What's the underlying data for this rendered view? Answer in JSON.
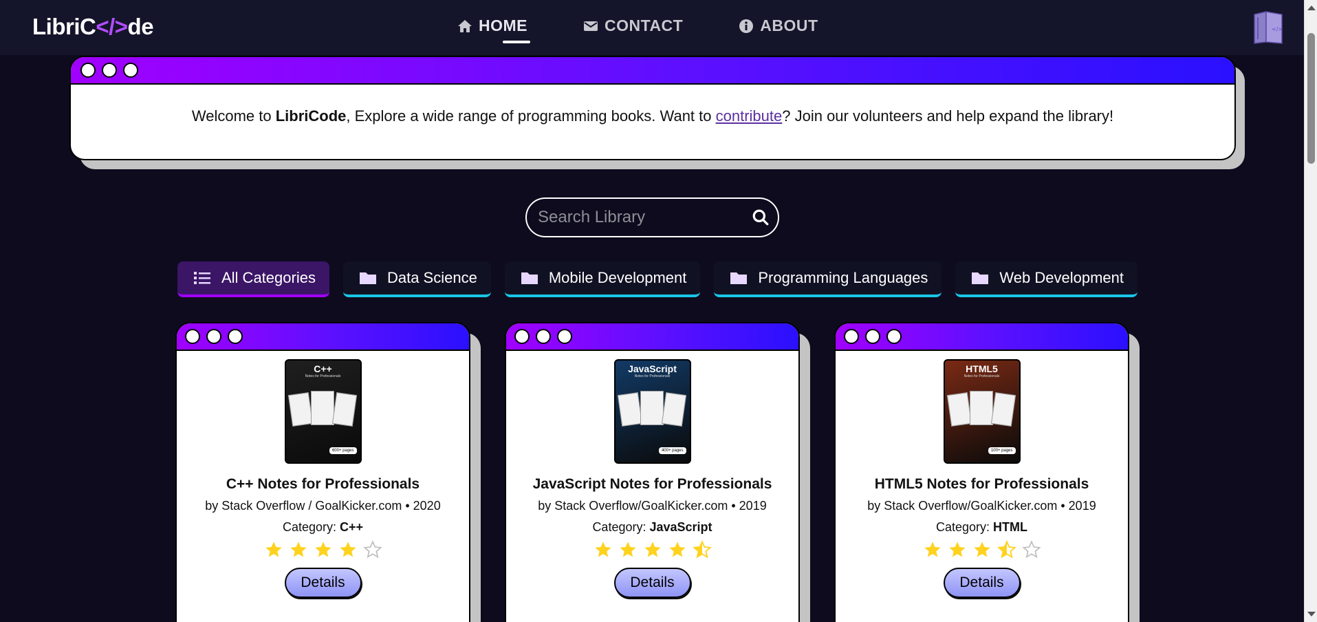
{
  "nav": {
    "logo_prefix": "LibriC",
    "logo_code": "</>",
    "logo_suffix": "de",
    "links": [
      {
        "label": "HOME",
        "icon": "home-icon"
      },
      {
        "label": "CONTACT",
        "icon": "envelope-icon"
      },
      {
        "label": "ABOUT",
        "icon": "info-icon"
      }
    ]
  },
  "welcome": {
    "pre": "Welcome to ",
    "brand": "LibriCode",
    "mid": ", Explore a wide range of programming books. Want to ",
    "link": "contribute",
    "post": "? Join our volunteers and help expand the library!"
  },
  "search": {
    "placeholder": "Search Library"
  },
  "categories": [
    {
      "label": "All Categories",
      "icon": "list-icon"
    },
    {
      "label": "Data Science",
      "icon": "folder-icon"
    },
    {
      "label": "Mobile Development",
      "icon": "folder-icon"
    },
    {
      "label": "Programming Languages",
      "icon": "folder-icon"
    },
    {
      "label": "Web Development",
      "icon": "folder-icon"
    }
  ],
  "books": [
    {
      "cover_title": "C++",
      "cover_sub": "Notes for Professionals",
      "cover_pages": "600+ pages",
      "cover_color": "#1f1f1f",
      "title": "C++ Notes for Professionals",
      "meta": "by Stack Overflow / GoalKicker.com • 2020",
      "category_label": "Category: ",
      "category": "C++",
      "rating": 4,
      "details": "Details"
    },
    {
      "cover_title": "JavaScript",
      "cover_sub": "Notes for Professionals",
      "cover_pages": "400+ pages",
      "cover_color": "#123a66",
      "title": "JavaScript Notes for Professionals",
      "meta": "by Stack Overflow/GoalKicker.com • 2019",
      "category_label": "Category: ",
      "category": "JavaScript",
      "rating": 4.5,
      "details": "Details"
    },
    {
      "cover_title": "HTML5",
      "cover_sub": "Notes for Professionals",
      "cover_pages": "100+ pages",
      "cover_color": "#7a2a14",
      "title": "HTML5 Notes for Professionals",
      "meta": "by Stack Overflow/GoalKicker.com • 2019",
      "category_label": "Category: ",
      "category": "HTML",
      "rating": 3.5,
      "details": "Details"
    }
  ],
  "colors": {
    "background": "#0d0b1d",
    "accent": "#a100ff",
    "cyan": "#19c6e6",
    "star": "#ffd21f"
  }
}
